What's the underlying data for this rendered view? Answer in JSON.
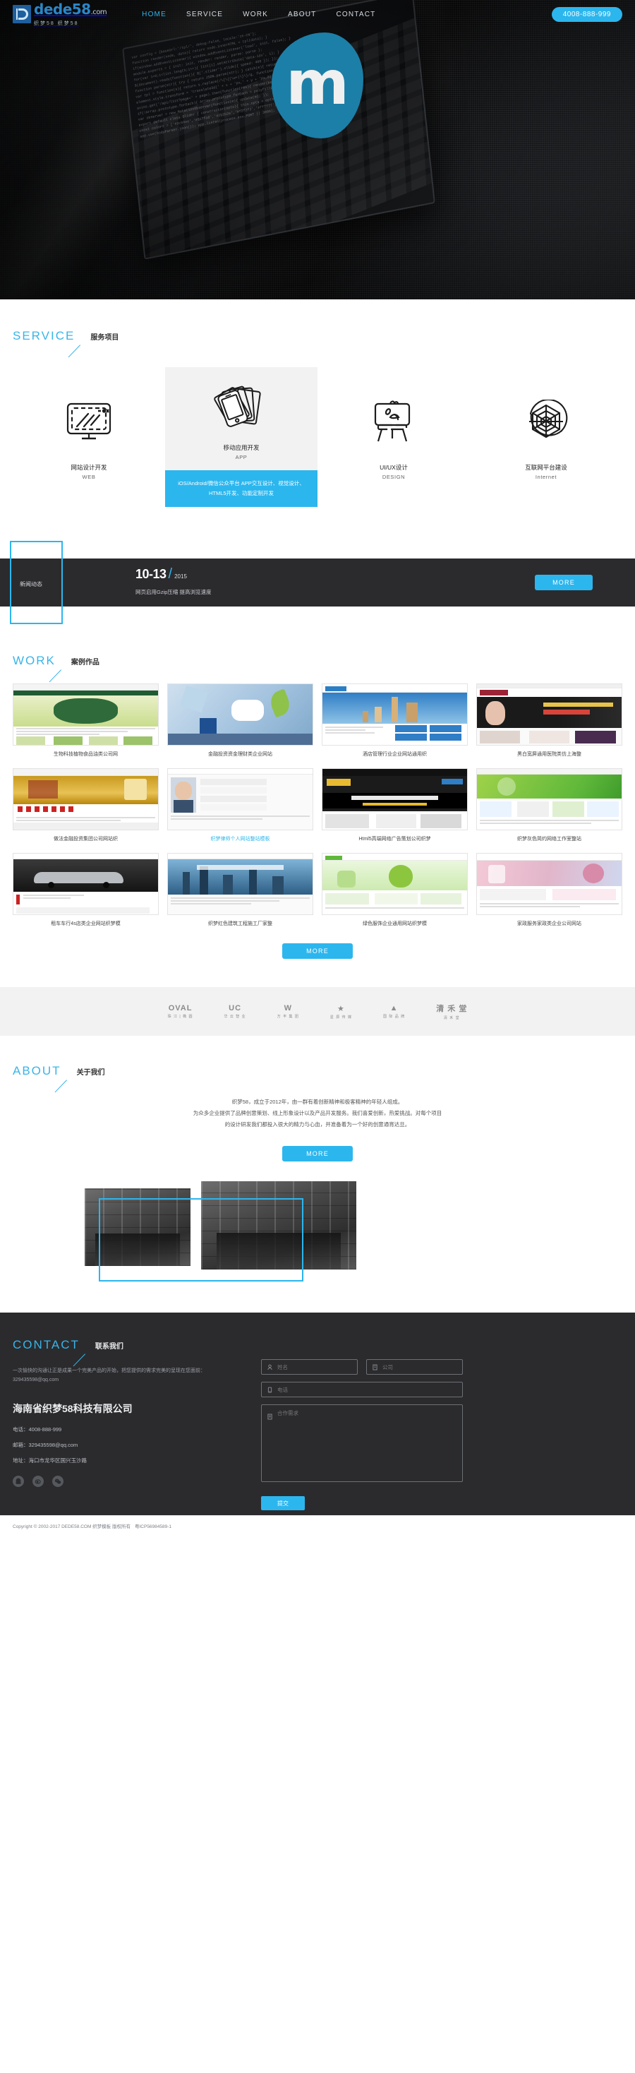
{
  "header": {
    "logo": {
      "word": "dede",
      "num": "58",
      "dot": ".com",
      "sub": "织梦58  织梦58"
    },
    "nav": [
      {
        "label": "HOME",
        "active": true
      },
      {
        "label": "SERVICE",
        "active": false
      },
      {
        "label": "WORK",
        "active": false
      },
      {
        "label": "ABOUT",
        "active": false
      },
      {
        "label": "CONTACT",
        "active": false
      }
    ],
    "hotline": "4008-888-999",
    "hero_letter": "m",
    "hero_code": "<div class=\"row\">var config = {baseUrl:'/tpl/', debug:false};\nfunction render(node, data){ return node.innerHTML = tpl(data); }\nif(window.addEventListener){ window.addEventListener('load', init, false); }\nmodule.exports = { init: init, render: render, parse: parse };\nfor(var i=0;i<list.length;i++){ list[i].setAttribute('data-idx', i); }</div>"
  },
  "service": {
    "title_en": "SERVICE",
    "title_cn": "服务项目",
    "items": [
      {
        "icon": "monitor-icon",
        "name": "网站设计开发",
        "en": "WEB",
        "featured": false,
        "desc": ""
      },
      {
        "icon": "mobile-cards-icon",
        "name": "移动应用开发",
        "en": "APP",
        "featured": true,
        "desc": "iOS/Android/微信公众平台 APP交互设计、视觉设计、HTML5开发、功能定制开发"
      },
      {
        "icon": "easel-icon",
        "name": "UI/UX设计",
        "en": "DESIGN",
        "featured": false,
        "desc": ""
      },
      {
        "icon": "web-globe-icon",
        "name": "互联网平台建设",
        "en": "Internet",
        "featured": false,
        "desc": ""
      }
    ]
  },
  "news": {
    "label": "新闻动态",
    "date": "10-13",
    "year": "2015",
    "text": "网页启用Gzip压缩 提高浏览速度",
    "more_label": "MORE"
  },
  "work": {
    "title_en": "WORK",
    "title_cn": "案例作品",
    "more_label": "MORE",
    "items": [
      {
        "caption": "生物科技植物食品油类公司网",
        "highlight": false,
        "style": "green"
      },
      {
        "caption": "金融投资资金理财类企业网站",
        "highlight": false,
        "style": "bluehero"
      },
      {
        "caption": "酒店管理行业企业网站通用织",
        "highlight": false,
        "style": "bluecity"
      },
      {
        "caption": "黑白宽屏通用医院类仿上海整",
        "highlight": false,
        "style": "beauty"
      },
      {
        "caption": "做法金融投资集团公司网站织",
        "highlight": false,
        "style": "redgold"
      },
      {
        "caption": "织梦律师个人网站整站模板",
        "highlight": true,
        "style": "lawyer"
      },
      {
        "caption": "Html5高端网络广告策划公司织梦",
        "highlight": false,
        "style": "darkagency"
      },
      {
        "caption": "织梦灰色简约网络工作室整站",
        "highlight": false,
        "style": "greenstudio"
      },
      {
        "caption": "租车车行4s店类企业网站织梦模",
        "highlight": false,
        "style": "car"
      },
      {
        "caption": "织梦红色建筑工程施工厂家整",
        "highlight": false,
        "style": "city2"
      },
      {
        "caption": "绿色服饰企业通用网站织梦模",
        "highlight": false,
        "style": "greensite"
      },
      {
        "caption": "家政服务家政类企业公司网站",
        "highlight": false,
        "style": "service"
      }
    ]
  },
  "partners": [
    {
      "name": "OVAL",
      "sub": "珠 江 | 椭 圆"
    },
    {
      "name": "UC",
      "sub": "华 云 智 业"
    },
    {
      "name": "W",
      "sub": "万 丰 集 团"
    },
    {
      "name": "★",
      "sub": "星 辰 传 媒"
    },
    {
      "name": "▲",
      "sub": "国 际 品 牌"
    },
    {
      "name": "清 禾 堂",
      "sub": "清 禾 堂"
    }
  ],
  "about": {
    "title_en": "ABOUT",
    "title_cn": "关于我们",
    "paragraphs": [
      "织梦58，成立于2012年，由一群有着创新精神和极客精神的年轻人组成。",
      "为众多企业提供了品牌创意策划、线上形象设计以及产品开发服务。我们喜爱创新，热爱挑战。对每个项目",
      "的设计研发我们都投入很大的精力与心血，并准备着为一个好的创意通宵达旦。"
    ],
    "more_label": "MORE"
  },
  "contact": {
    "title_en": "CONTACT",
    "title_cn": "联系我们",
    "intro": "一次愉快的沟通让正是成果一个完美产品的开始，把您提供的需求完美的呈现在您面前：329435598@qq.com",
    "company": "海南省织梦58科技有限公司",
    "lines": [
      "电话：4008-888-999",
      "邮箱：329435598@qq.com",
      "地址：海口市龙华区国兴玉沙路"
    ],
    "socials": [
      "qq-icon",
      "weibo-icon",
      "wechat-icon"
    ],
    "form": {
      "name_placeholder": "姓名",
      "company_placeholder": "公司",
      "tel_placeholder": "电话",
      "request_placeholder": "合作需求",
      "submit_label": "提交"
    }
  },
  "footer": {
    "copyright": "Copyright © 2002-2017 DEDE58.COM 织梦模板 版权所有",
    "icp": "粤ICP56984589-1"
  },
  "colors": {
    "accent": "#2cb6ee",
    "dark": "#2b2b2e",
    "heroBlob": "#1c7fa8",
    "titleBlue": "#39b4e8"
  }
}
